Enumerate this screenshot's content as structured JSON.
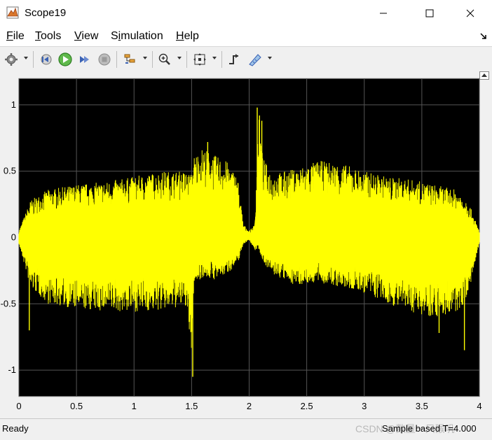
{
  "window": {
    "title": "Scope19",
    "icons": [
      "matlab-scope-icon",
      "minimize-icon",
      "maximize-icon",
      "close-icon"
    ]
  },
  "menu": {
    "items": [
      {
        "label": "File",
        "mnemonic": "F"
      },
      {
        "label": "Tools",
        "mnemonic": "T"
      },
      {
        "label": "View",
        "mnemonic": "V"
      },
      {
        "label": "Simulation",
        "mnemonic": "i"
      },
      {
        "label": "Help",
        "mnemonic": "H"
      }
    ],
    "dock_icon": "dock-arrow-icon"
  },
  "toolbar": {
    "icons": [
      "settings-gear-icon",
      "step-back-icon",
      "run-icon",
      "step-forward-icon",
      "stop-icon",
      "signal-selector-icon",
      "zoom-in-icon",
      "fit-to-view-icon",
      "triggers-icon",
      "measurements-icon"
    ]
  },
  "status": {
    "left": "Ready",
    "right": "Sample based   T=4.000",
    "watermark": "CSDN @数量一只猴叽"
  },
  "chart_data": {
    "type": "line",
    "title": "",
    "xlabel": "",
    "ylabel": "",
    "xlim": [
      0,
      4
    ],
    "ylim": [
      -1.2,
      1.2
    ],
    "xticks": [
      0,
      0.5,
      1,
      1.5,
      2,
      2.5,
      3,
      3.5,
      4
    ],
    "xtick_labels": [
      "0",
      "0.5",
      "1",
      "1.5",
      "2",
      "2.5",
      "3",
      "3.5",
      "4"
    ],
    "yticks": [
      1,
      0.5,
      0,
      -0.5,
      -1
    ],
    "ytick_labels": [
      "1",
      "0.5",
      "0",
      "-0.5",
      "-1"
    ],
    "grid": true,
    "background": "#000000",
    "grid_color": "#555555",
    "series": [
      {
        "color": "#ffff00",
        "envelope": {
          "x": [
            0.0,
            0.1,
            0.25,
            0.5,
            0.75,
            1.0,
            1.25,
            1.45,
            1.5,
            1.52,
            1.6,
            1.7,
            1.8,
            1.9,
            1.95,
            2.0,
            2.05,
            2.08,
            2.12,
            2.2,
            2.4,
            2.6,
            2.8,
            3.0,
            3.2,
            3.4,
            3.6,
            3.8,
            3.9,
            4.0
          ],
          "upper": [
            0.05,
            0.28,
            0.36,
            0.4,
            0.42,
            0.46,
            0.5,
            0.5,
            0.48,
            0.62,
            0.68,
            0.62,
            0.58,
            0.46,
            0.1,
            0.05,
            0.1,
            0.95,
            0.6,
            0.48,
            0.52,
            0.58,
            0.56,
            0.5,
            0.46,
            0.44,
            0.4,
            0.36,
            0.28,
            0.05
          ],
          "lower": [
            -0.05,
            -0.38,
            -0.5,
            -0.54,
            -0.56,
            -0.56,
            -0.55,
            -0.52,
            -0.9,
            -0.35,
            -0.3,
            -0.32,
            -0.28,
            -0.2,
            -0.05,
            -0.02,
            -0.1,
            -0.08,
            -0.18,
            -0.28,
            -0.36,
            -0.34,
            -0.38,
            -0.42,
            -0.5,
            -0.56,
            -0.6,
            -0.58,
            -0.45,
            -0.05
          ],
          "spikes": [
            {
              "x": 1.51,
              "y": -1.05
            },
            {
              "x": 1.64,
              "y": 0.72
            },
            {
              "x": 2.07,
              "y": 0.98
            },
            {
              "x": 2.09,
              "y": 0.92
            },
            {
              "x": 2.11,
              "y": 0.88
            },
            {
              "x": 3.65,
              "y": -0.72
            },
            {
              "x": 3.87,
              "y": -0.85
            },
            {
              "x": 0.09,
              "y": -0.7
            }
          ]
        }
      }
    ]
  }
}
